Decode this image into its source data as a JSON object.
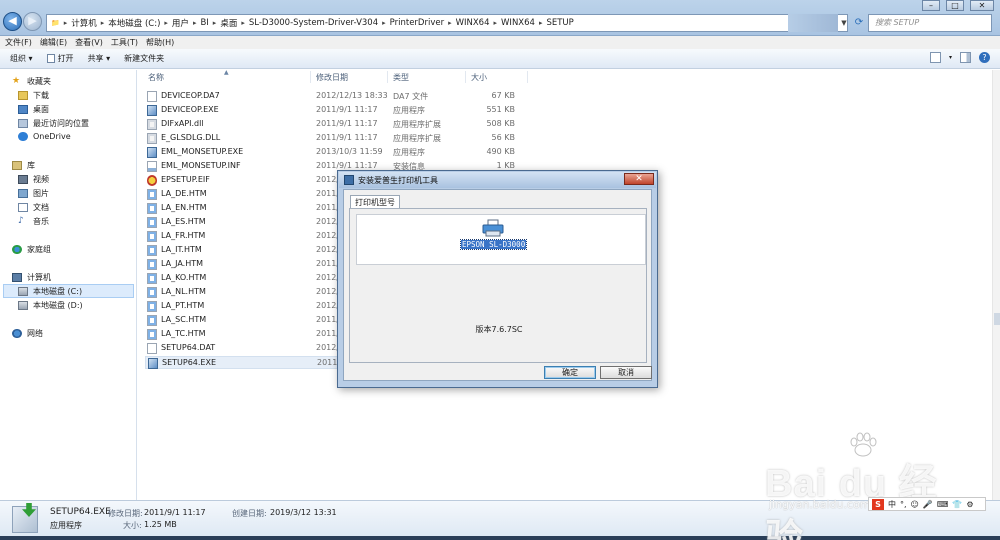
{
  "address": {
    "segments": [
      "计算机",
      "本地磁盘 (C:)",
      "用户",
      "BI",
      "桌面",
      "SL-D3000-System-Driver-V304",
      "PrinterDriver",
      "WINX64",
      "WINX64",
      "SETUP"
    ],
    "search_placeholder": "搜索 SETUP"
  },
  "menu": [
    "文件(F)",
    "编辑(E)",
    "查看(V)",
    "工具(T)",
    "帮助(H)"
  ],
  "toolbar": {
    "organize": "组织 ▾",
    "open": "打开",
    "share": "共享 ▾",
    "new_folder": "新建文件夹"
  },
  "nav": {
    "favorites": "收藏夹",
    "downloads": "下载",
    "desktop": "桌面",
    "recent": "最近访问的位置",
    "onedrive": "OneDrive",
    "library": "库",
    "videos": "视频",
    "pictures": "图片",
    "documents": "文档",
    "music": "音乐",
    "homegroup": "家庭组",
    "computer": "计算机",
    "drive_c": "本地磁盘 (C:)",
    "drive_d": "本地磁盘 (D:)",
    "network": "网络"
  },
  "columns": {
    "name": "名称",
    "date": "修改日期",
    "type": "类型",
    "size": "大小"
  },
  "files": [
    {
      "name": "DEVICEOP.DA7",
      "date": "2012/12/13 18:33",
      "type": "DA7 文件",
      "size": "67 KB",
      "icon": "blank-file-icon"
    },
    {
      "name": "DEVICEOP.EXE",
      "date": "2011/9/1 11:17",
      "type": "应用程序",
      "size": "551 KB",
      "icon": "exe-icon"
    },
    {
      "name": "DIFxAPI.dll",
      "date": "2011/9/1 11:17",
      "type": "应用程序扩展",
      "size": "508 KB",
      "icon": "dll-icon"
    },
    {
      "name": "E_GLSDLG.DLL",
      "date": "2011/9/1 11:17",
      "type": "应用程序扩展",
      "size": "56 KB",
      "icon": "dll-icon"
    },
    {
      "name": "EML_MONSETUP.EXE",
      "date": "2013/10/3 11:59",
      "type": "应用程序",
      "size": "490 KB",
      "icon": "exe-icon"
    },
    {
      "name": "EML_MONSETUP.INF",
      "date": "2011/9/1 11:17",
      "type": "安装信息",
      "size": "1 KB",
      "icon": "inf-icon"
    },
    {
      "name": "EPSETUP.EIF",
      "date": "2012/",
      "type": "",
      "size": "",
      "icon": "eif-icon"
    },
    {
      "name": "LA_DE.HTM",
      "date": "2011/",
      "type": "",
      "size": "",
      "icon": "htm-icon"
    },
    {
      "name": "LA_EN.HTM",
      "date": "2011/",
      "type": "",
      "size": "",
      "icon": "htm-icon"
    },
    {
      "name": "LA_ES.HTM",
      "date": "2012/",
      "type": "",
      "size": "",
      "icon": "htm-icon"
    },
    {
      "name": "LA_FR.HTM",
      "date": "2012/",
      "type": "",
      "size": "",
      "icon": "htm-icon"
    },
    {
      "name": "LA_IT.HTM",
      "date": "2012/",
      "type": "",
      "size": "",
      "icon": "htm-icon"
    },
    {
      "name": "LA_JA.HTM",
      "date": "2011/",
      "type": "",
      "size": "",
      "icon": "htm-icon"
    },
    {
      "name": "LA_KO.HTM",
      "date": "2012/",
      "type": "",
      "size": "",
      "icon": "htm-icon"
    },
    {
      "name": "LA_NL.HTM",
      "date": "2012/",
      "type": "",
      "size": "",
      "icon": "htm-icon"
    },
    {
      "name": "LA_PT.HTM",
      "date": "2012/",
      "type": "",
      "size": "",
      "icon": "htm-icon"
    },
    {
      "name": "LA_SC.HTM",
      "date": "2011/",
      "type": "",
      "size": "",
      "icon": "htm-icon"
    },
    {
      "name": "LA_TC.HTM",
      "date": "2011/",
      "type": "",
      "size": "",
      "icon": "htm-icon"
    },
    {
      "name": "SETUP64.DAT",
      "date": "2012/",
      "type": "",
      "size": "",
      "icon": "blank-file-icon"
    },
    {
      "name": "SETUP64.EXE",
      "date": "2011/",
      "type": "",
      "size": "",
      "icon": "exe-icon",
      "selected": true
    }
  ],
  "dialog": {
    "title": "安装爱普生打印机工具",
    "tab": "打印机型号",
    "printer": "EPSON SL-D3000",
    "version": "版本7.6.7SC",
    "ok": "确定",
    "cancel": "取消"
  },
  "details": {
    "filename": "SETUP64.EXE",
    "filetype": "应用程序",
    "modified_label": "修改日期:",
    "modified": "2011/9/1 11:17",
    "created_label": "创建日期:",
    "created": "2019/3/12 13:31",
    "size_label": "大小:",
    "size": "1.25 MB"
  },
  "watermark": {
    "brand": "Bai du 经验",
    "url": "jingyan.baidu.com"
  },
  "ime": {
    "label": "中"
  }
}
